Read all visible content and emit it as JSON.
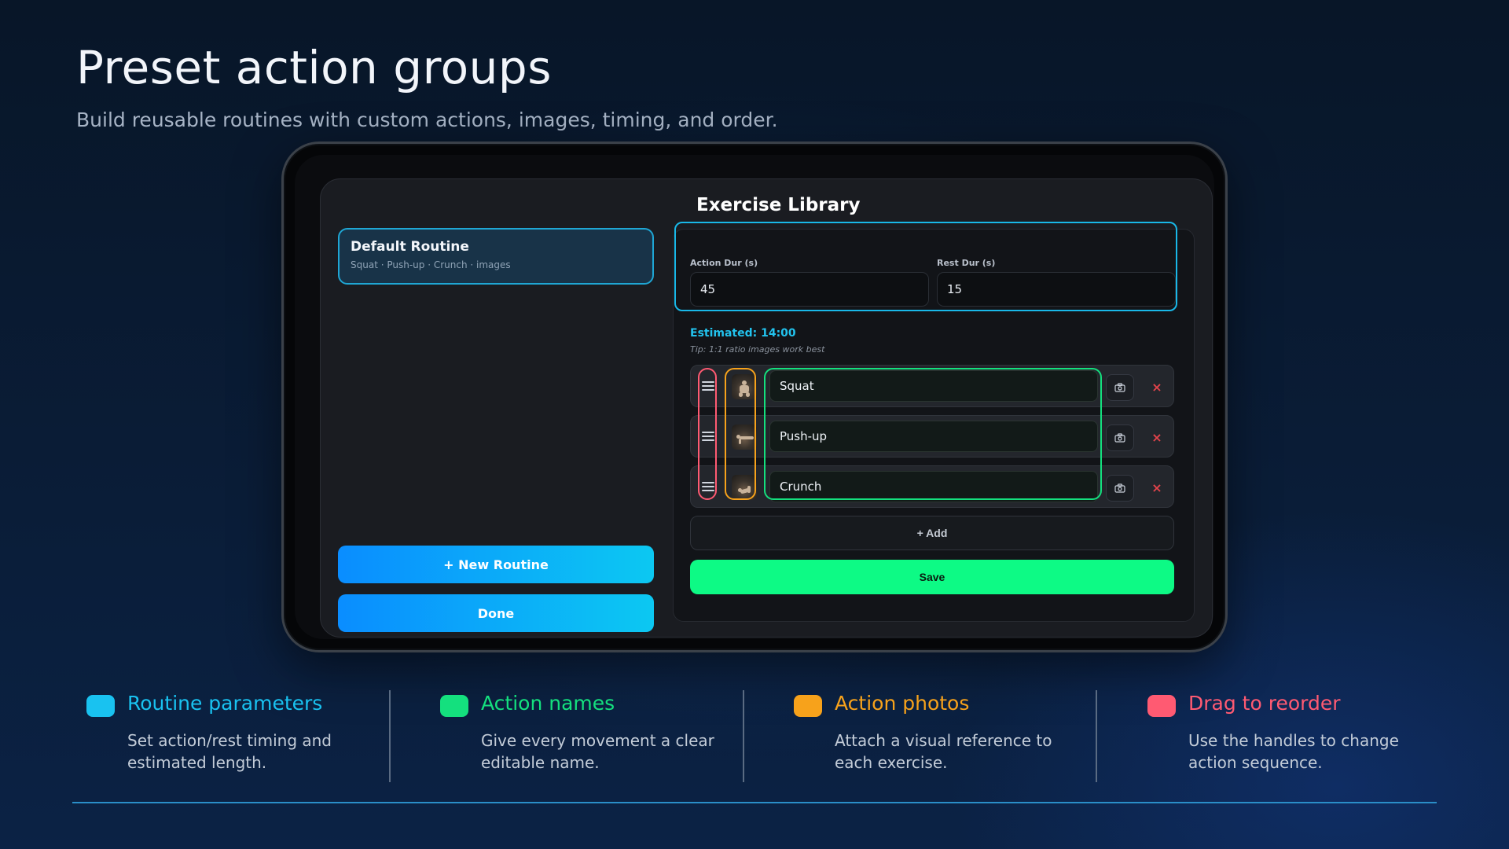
{
  "headline": "Preset action groups",
  "subheadline": "Build reusable routines with custom actions, images, timing, and order.",
  "sidebar": {
    "routines": [
      {
        "name": "Default Routine",
        "summary": "Squat · Push-up · Crunch · images"
      }
    ],
    "new_routine_label": "+ New Routine",
    "done_label": "Done"
  },
  "library": {
    "title": "Exercise Library",
    "action_dur_label": "Action Dur (s)",
    "action_dur_value": "45",
    "rest_dur_label": "Rest Dur (s)",
    "rest_dur_value": "15",
    "estimated": "Estimated: 14:00",
    "tip": "Tip: 1:1 ratio images work best",
    "actions": [
      {
        "name": "Squat",
        "delete_glyph": "×"
      },
      {
        "name": "Push-up",
        "delete_glyph": "×"
      },
      {
        "name": "Crunch",
        "delete_glyph": "×"
      }
    ],
    "add_label": "+ Add",
    "save_label": "Save"
  },
  "legend": [
    {
      "title": "Routine parameters",
      "desc": "Set action/rest timing and estimated length.",
      "color": "#19c2f0"
    },
    {
      "title": "Action names",
      "desc": "Give every movement a clear editable name.",
      "color": "#14e07e"
    },
    {
      "title": "Action photos",
      "desc": "Attach a visual reference to each exercise.",
      "color": "#f7a21b"
    },
    {
      "title": "Drag to reorder",
      "desc": "Use the handles to change action sequence.",
      "color": "#ff5a72"
    }
  ],
  "colors": {
    "accent_cyan": "#19c2f0",
    "accent_green": "#14e07e",
    "accent_orange": "#f7a21b",
    "accent_pink": "#ff5a72",
    "save_green": "#0dfa85"
  }
}
